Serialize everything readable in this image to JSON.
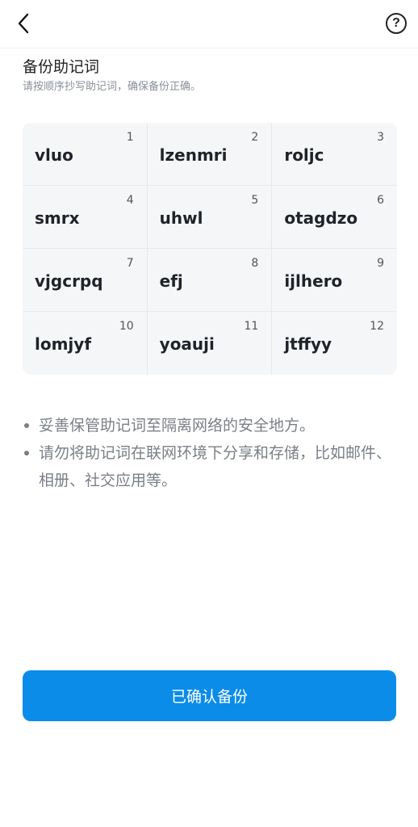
{
  "header": {
    "back_icon": "chevron-left-icon",
    "help_icon": "question-circle-icon",
    "help_glyph": "?"
  },
  "page": {
    "title": "备份助记词",
    "subtitle": "请按顺序抄写助记词，确保备份正确。"
  },
  "mnemonic": [
    {
      "index": "1",
      "word": "vluo"
    },
    {
      "index": "2",
      "word": "lzenmri"
    },
    {
      "index": "3",
      "word": "roljc"
    },
    {
      "index": "4",
      "word": "smrx"
    },
    {
      "index": "5",
      "word": "uhwl"
    },
    {
      "index": "6",
      "word": "otagdzo"
    },
    {
      "index": "7",
      "word": "vjgcrpq"
    },
    {
      "index": "8",
      "word": "efj"
    },
    {
      "index": "9",
      "word": "ijlhero"
    },
    {
      "index": "10",
      "word": "lomjyf"
    },
    {
      "index": "11",
      "word": "yoauji"
    },
    {
      "index": "12",
      "word": "jtffyy"
    }
  ],
  "tips": [
    "妥善保管助记词至隔离网络的安全地方。",
    "请勿将助记词在联网环境下分享和存储，比如邮件、相册、社交应用等。"
  ],
  "confirm_button": {
    "label": "已确认备份",
    "color": "#0b8ce9"
  }
}
